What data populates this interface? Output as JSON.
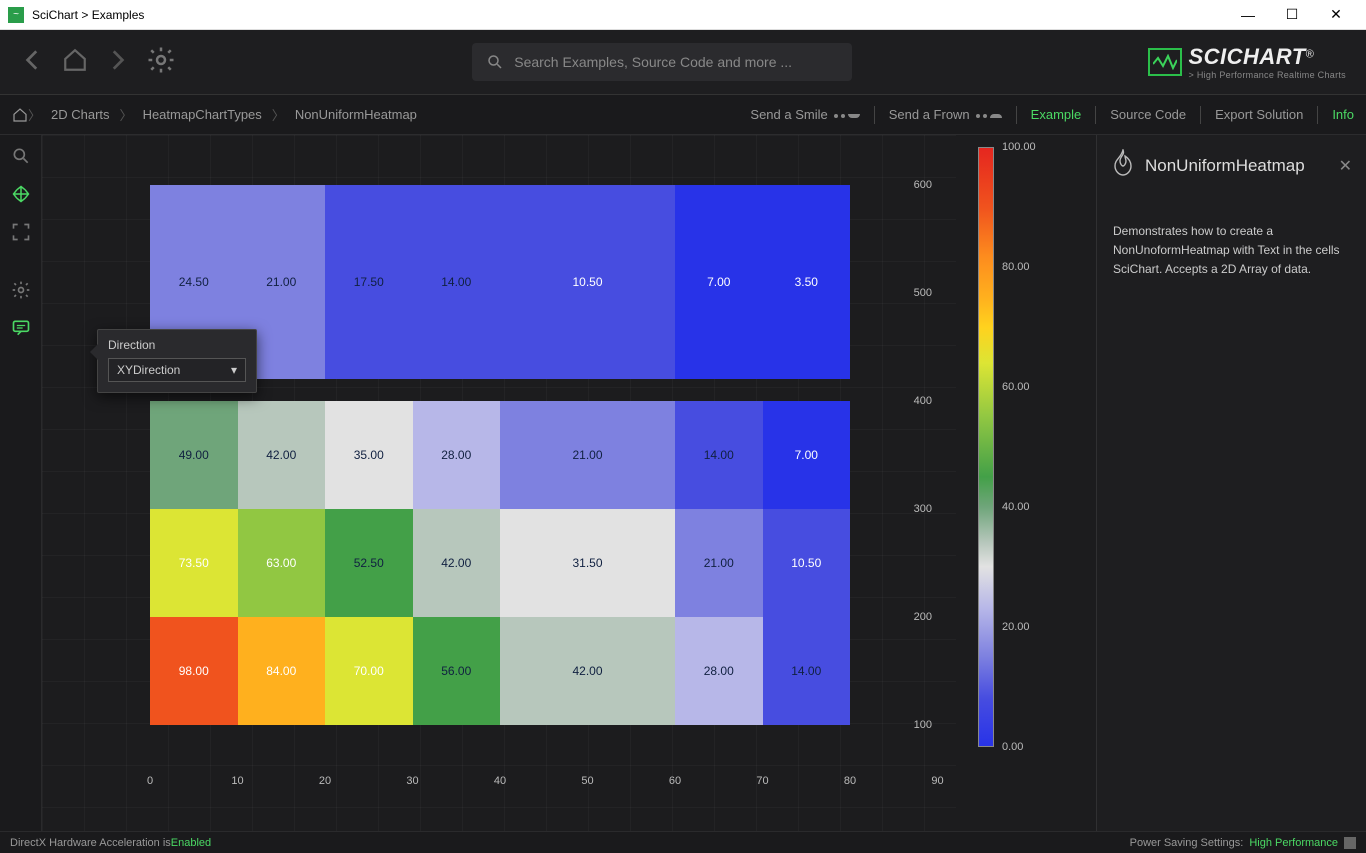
{
  "window": {
    "title": "SciChart > Examples"
  },
  "topnav": {
    "search_placeholder": "Search Examples, Source Code and more ...",
    "brand": "SCICHART",
    "brand_reg": "®",
    "brand_sub": "> High Performance Realtime Charts"
  },
  "breadcrumb": {
    "items": [
      "2D Charts",
      "HeatmapChartTypes",
      "NonUniformHeatmap"
    ],
    "send_smile": "Send a Smile",
    "send_frown": "Send a Frown",
    "tabs": {
      "example": "Example",
      "source": "Source Code",
      "export": "Export Solution",
      "info": "Info"
    }
  },
  "float": {
    "label": "Direction",
    "value": "XYDirection"
  },
  "infopanel": {
    "title": "NonUniformHeatmap",
    "body": "Demonstrates how to create a NonUnoformHeatmap with Text in the cells SciChart. Accepts a 2D Array of data."
  },
  "statusbar": {
    "left_a": "DirectX Hardware Acceleration is ",
    "left_b": "Enabled",
    "right_a": "Power Saving Settings: ",
    "right_b": "High Performance"
  },
  "chart_data": {
    "type": "heatmap",
    "x_edges": [
      0,
      10,
      20,
      30,
      40,
      60,
      70,
      80
    ],
    "y_edges": [
      100,
      200,
      300,
      400,
      420,
      600
    ],
    "x_ticks": [
      0,
      10,
      20,
      30,
      40,
      50,
      60,
      70,
      80,
      90
    ],
    "y_ticks": [
      100,
      200,
      300,
      400,
      500,
      600
    ],
    "rows": [
      {
        "y0": 100,
        "y1": 200,
        "values": [
          98.0,
          84.0,
          70.0,
          56.0,
          42.0,
          28.0,
          14.0
        ]
      },
      {
        "y0": 200,
        "y1": 300,
        "values": [
          73.5,
          63.0,
          52.5,
          42.0,
          31.5,
          21.0,
          10.5
        ]
      },
      {
        "y0": 300,
        "y1": 400,
        "values": [
          49.0,
          42.0,
          35.0,
          28.0,
          21.0,
          14.0,
          7.0
        ]
      },
      {
        "y0": 420,
        "y1": 600,
        "values": [
          24.5,
          21.0,
          17.5,
          14.0,
          10.5,
          7.0,
          3.5
        ]
      }
    ],
    "colorbar_ticks": [
      100.0,
      80.0,
      60.0,
      40.0,
      20.0,
      0.0
    ],
    "colorbar_range": [
      0,
      100
    ]
  }
}
